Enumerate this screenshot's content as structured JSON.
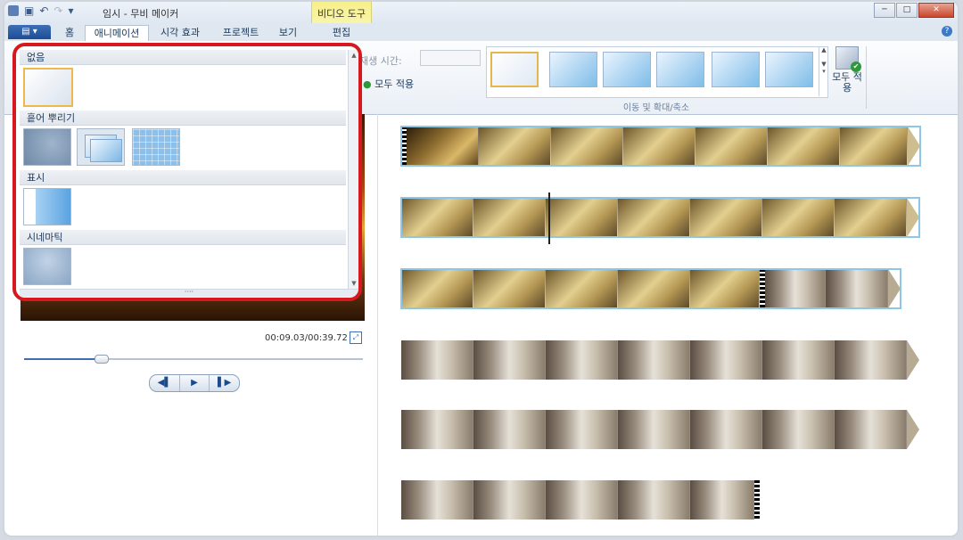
{
  "window": {
    "title": "임시 - 무비 메이커",
    "context_group": "비디오 도구",
    "buttons": {
      "minimize": "─",
      "maximize": "□",
      "close": "✕"
    }
  },
  "quick_access": {
    "undo_icon": "undo-icon",
    "redo_icon": "redo-icon",
    "save_icon": "save-icon",
    "dropdown": "▾"
  },
  "tabs": {
    "file": "▤ ▾",
    "home": "홈",
    "animations": "애니메이션",
    "visual_effects": "시각 효과",
    "project": "프로젝트",
    "view": "보기",
    "edit": "편집",
    "help": "?"
  },
  "ribbon": {
    "duration_label": "재생 시간:",
    "apply_all_small": "모두 적용",
    "pan_zoom_group": "이동 및 확대/축소",
    "apply_all_big": "모두 적용"
  },
  "transition_gallery": {
    "sections": [
      {
        "title": "없음",
        "items": [
          "none"
        ]
      },
      {
        "title": "흩어 뿌리기",
        "items": [
          "blur",
          "stack",
          "mosaic"
        ]
      },
      {
        "title": "표시",
        "items": [
          "reveal"
        ]
      },
      {
        "title": "시네마틱",
        "items": [
          "cinematic"
        ]
      }
    ],
    "grip": "····"
  },
  "preview": {
    "time": "00:09.03/00:39.72",
    "progress": 0.227
  },
  "transport": {
    "prev": "◀▌",
    "play": "▶",
    "next": "▌▶"
  }
}
